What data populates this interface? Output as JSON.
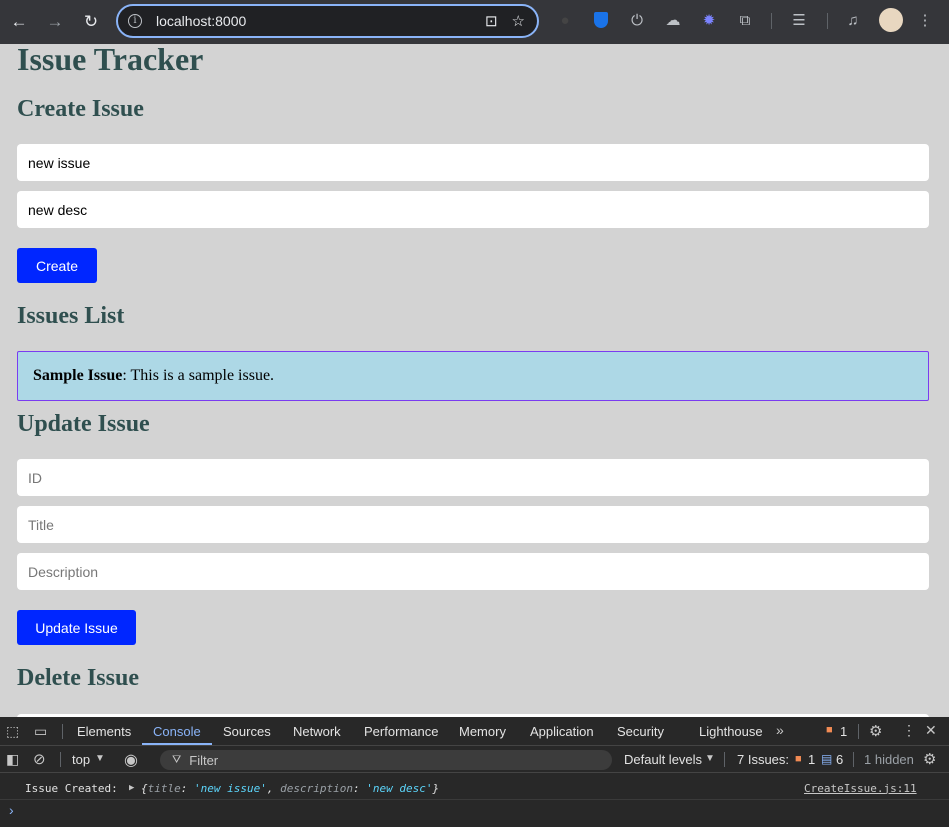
{
  "browser": {
    "url": "localhost:8000",
    "back_icon": "arrow-left-icon",
    "forward_icon": "arrow-right-icon",
    "reload_icon": "reload-icon"
  },
  "page": {
    "title": "Issue Tracker",
    "create": {
      "heading": "Create Issue",
      "title_value": "new issue",
      "description_value": "new desc",
      "button_label": "Create"
    },
    "list": {
      "heading": "Issues List",
      "items": [
        {
          "title": "Sample Issue",
          "description": ": This is a sample issue."
        }
      ]
    },
    "update": {
      "heading": "Update Issue",
      "id_placeholder": "ID",
      "title_placeholder": "Title",
      "description_placeholder": "Description",
      "button_label": "Update Issue"
    },
    "delete": {
      "heading": "Delete Issue"
    }
  },
  "devtools": {
    "tabs": [
      "Elements",
      "Console",
      "Sources",
      "Network",
      "Performance",
      "Memory",
      "Application",
      "Security",
      "Lighthouse"
    ],
    "active_tab": "Console",
    "error_badge_count": "1",
    "context": "top",
    "filter_placeholder": "Filter",
    "levels": "Default levels",
    "issues_label": "7 Issues:",
    "issues_errors": "1",
    "issues_info": "6",
    "hidden": "1 hidden",
    "log": {
      "label": "Issue Created:",
      "obj_open": "{",
      "key1": "title",
      "val1": "'new issue'",
      "key2": "description",
      "val2": "'new desc'",
      "obj_close": "}",
      "source": "CreateIssue.js:11"
    },
    "prompt": "›"
  },
  "colors": {
    "heading": "#2f4f4f",
    "button": "#0026ff",
    "card_bg": "#add8e6",
    "card_border": "#7a3cf0",
    "page_bg": "#d3d3d3"
  }
}
